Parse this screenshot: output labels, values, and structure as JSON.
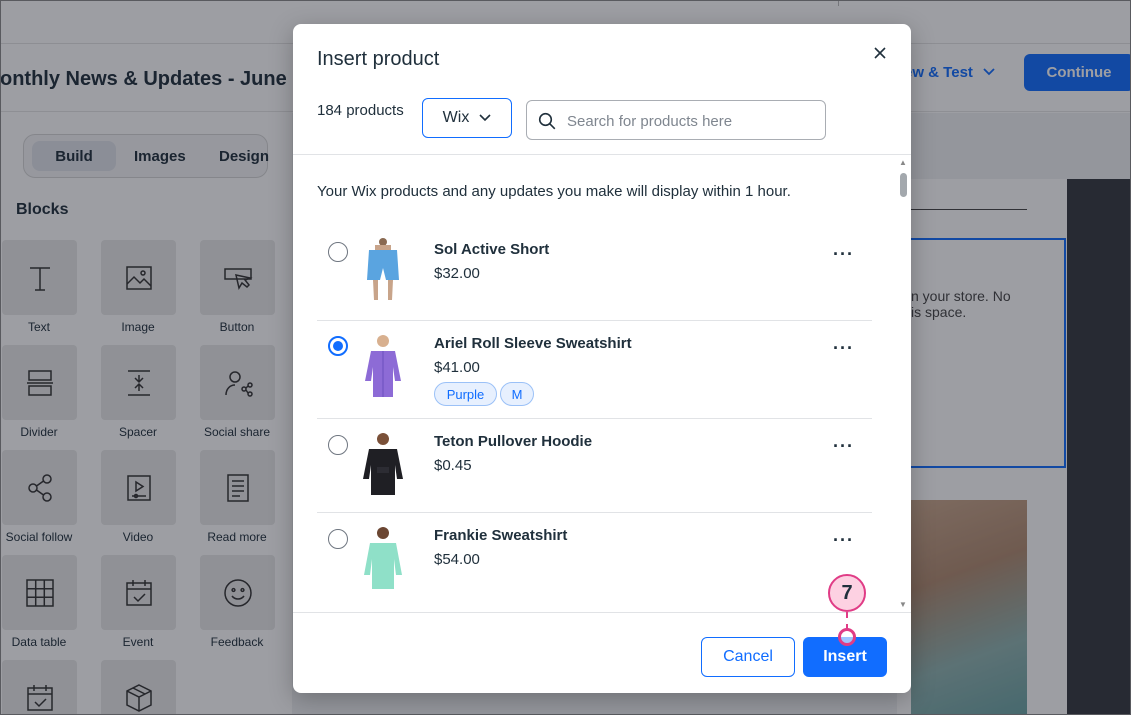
{
  "header": {
    "campaign_title": "onthly News & Updates - June",
    "preview_label": "ew & Test",
    "continue_label": "Continue"
  },
  "sidebar": {
    "tabs": [
      "Build",
      "Images",
      "Design"
    ],
    "blocks_title": "Blocks",
    "blocks": [
      {
        "label": "Text",
        "icon": "text-icon"
      },
      {
        "label": "Image",
        "icon": "image-icon"
      },
      {
        "label": "Button",
        "icon": "button-icon"
      },
      {
        "label": "Divider",
        "icon": "divider-icon"
      },
      {
        "label": "Spacer",
        "icon": "spacer-icon"
      },
      {
        "label": "Social share",
        "icon": "social-share-icon"
      },
      {
        "label": "Social follow",
        "icon": "social-follow-icon"
      },
      {
        "label": "Video",
        "icon": "video-icon"
      },
      {
        "label": "Read more",
        "icon": "read-more-icon"
      },
      {
        "label": "Data table",
        "icon": "data-table-icon"
      },
      {
        "label": "Event",
        "icon": "event-icon"
      },
      {
        "label": "Feedback",
        "icon": "feedback-icon"
      }
    ]
  },
  "email_preview": {
    "text_line1": "n your store. No",
    "text_line2": "is space."
  },
  "modal": {
    "title": "Insert product",
    "product_count": "184 products",
    "store_filter": "Wix",
    "search_placeholder": "Search for products here",
    "info": "Your Wix products and any updates you make will display within 1 hour.",
    "products": [
      {
        "name": "Sol Active Short",
        "price": "$32.00",
        "selected": false,
        "tags": []
      },
      {
        "name": "Ariel Roll Sleeve Sweatshirt",
        "price": "$41.00",
        "selected": true,
        "tags": [
          "Purple",
          "M"
        ]
      },
      {
        "name": "Teton Pullover Hoodie",
        "price": "$0.45",
        "selected": false,
        "tags": []
      },
      {
        "name": "Frankie Sweatshirt",
        "price": "$54.00",
        "selected": false,
        "tags": []
      }
    ],
    "cancel_label": "Cancel",
    "insert_label": "Insert"
  },
  "annotation": {
    "step_number": "7",
    "color": "#e03c86"
  },
  "colors": {
    "accent": "#116dff",
    "text": "#20303c"
  }
}
